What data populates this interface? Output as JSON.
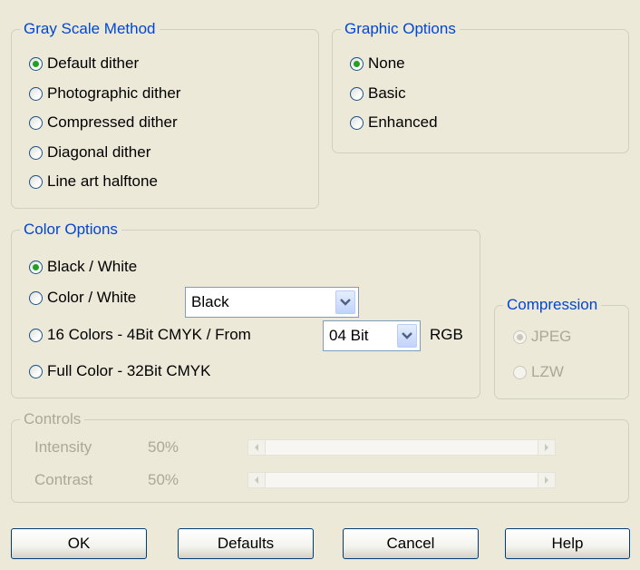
{
  "gray_scale": {
    "title": "Gray Scale Method",
    "options": [
      "Default dither",
      "Photographic dither",
      "Compressed dither",
      "Diagonal dither",
      "Line art halftone"
    ],
    "selected": "Default dither"
  },
  "graphic_options": {
    "title": "Graphic Options",
    "options": [
      "None",
      "Basic",
      "Enhanced"
    ],
    "selected": "None"
  },
  "color_options": {
    "title": "Color Options",
    "options": [
      "Black / White",
      "Color / White",
      "16 Colors - 4Bit CMYK / From",
      "Full Color - 32Bit CMYK"
    ],
    "selected": "Black / White",
    "color_combo_value": "Black",
    "bit_combo_value": "04 Bit",
    "rgb_label": "RGB"
  },
  "compression": {
    "title": "Compression",
    "options": [
      "JPEG",
      "LZW"
    ],
    "selected": "JPEG"
  },
  "controls": {
    "title": "Controls",
    "intensity_label": "Intensity",
    "intensity_value": "50%",
    "contrast_label": "Contrast",
    "contrast_value": "50%"
  },
  "buttons": {
    "ok": "OK",
    "defaults": "Defaults",
    "cancel": "Cancel",
    "help": "Help"
  },
  "colors": {
    "group_title": "#0046D5",
    "disabled_text": "#ACA899",
    "radio_check": "#21A121",
    "background": "#ECE9D8"
  }
}
